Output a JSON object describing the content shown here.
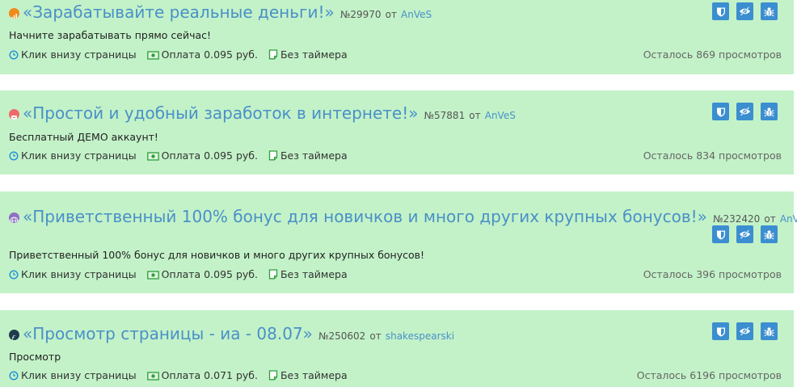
{
  "tasks": [
    {
      "icon": "orange-signal-icon",
      "title": "«Зарабатывайте реальные деньги!»",
      "number": "№29970",
      "ot": "от",
      "author": "AnVeS",
      "description": "Начните зарабатывать прямо сейчас!",
      "click": "Клик внизу страницы",
      "payment": "Оплата 0.095 руб.",
      "timer": "Без таймера",
      "remaining": "Осталось 869 просмотров"
    },
    {
      "icon": "red-gamepad-icon",
      "title": "«Простой и удобный заработок в интернете!»",
      "number": "№57881",
      "ot": "от",
      "author": "AnVeS",
      "description": "Бесплатный ДЕМО аккаунт!",
      "click": "Клик внизу страницы",
      "payment": "Оплата 0.095 руб.",
      "timer": "Без таймера",
      "remaining": "Осталось 834 просмотров"
    },
    {
      "icon": "globe-icon",
      "title": "«Приветственный 100% бонус для новичков и много других крупных бонусов!»",
      "number": "№232420",
      "ot": "от",
      "author": "AnVeS",
      "description": "Приветственный 100% бонус для новичков и много других крупных бонусов!",
      "click": "Клик внизу страницы",
      "payment": "Оплата 0.095 руб.",
      "timer": "Без таймера",
      "remaining": "Осталось 396 просмотров"
    },
    {
      "icon": "dark-f-logo-icon",
      "title": "«Просмотр страницы - иа - 08.07»",
      "number": "№250602",
      "ot": "от",
      "author": "shakespearski",
      "description": "Просмотр",
      "click": "Клик внизу страницы",
      "payment": "Оплата 0.071 руб.",
      "timer": "Без таймера",
      "remaining": "Осталось 6196 просмотров"
    }
  ]
}
